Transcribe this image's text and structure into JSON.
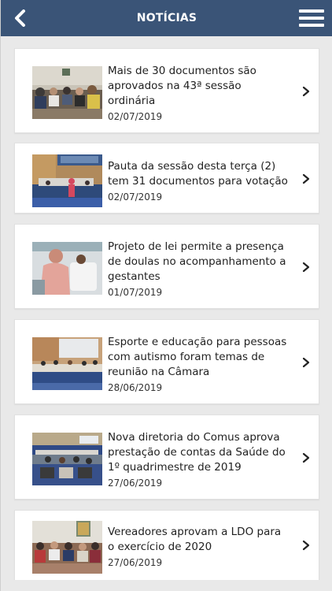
{
  "header": {
    "title": "NOTÍCIAS",
    "back_icon": "chevron-left-icon",
    "menu_icon": "hamburger-menu-icon",
    "bg_color": "#3a5477"
  },
  "news": [
    {
      "headline": "Mais de 30 documentos são aprovados na 43ª sessão ordinária",
      "date": "02/07/2019"
    },
    {
      "headline": "Pauta da sessão desta terça (2) tem 31 documentos para votação",
      "date": "02/07/2019"
    },
    {
      "headline": "Projeto de lei permite a presença de doulas no acompanhamento a gestantes",
      "date": "01/07/2019"
    },
    {
      "headline": "Esporte e educação para pessoas com autismo foram temas de reunião na Câmara",
      "date": "28/06/2019"
    },
    {
      "headline": "Nova diretoria do Comus aprova prestação de contas da Saúde do 1º quadrimestre de 2019",
      "date": "27/06/2019"
    },
    {
      "headline": "Vereadores aprovam a LDO para o exercício de 2020",
      "date": "27/06/2019"
    }
  ]
}
